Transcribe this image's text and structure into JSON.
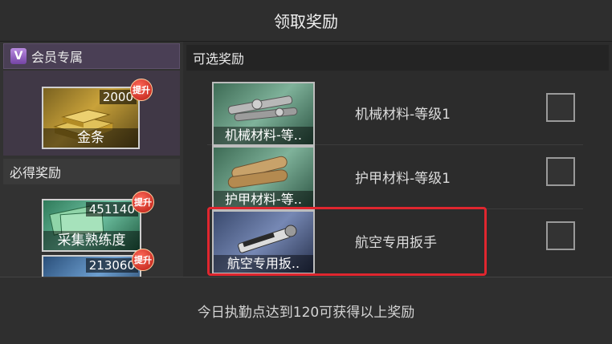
{
  "title": "领取奖励",
  "vip": {
    "header": "会员专属",
    "badge": "V",
    "item": {
      "qty": "2000",
      "name": "金条",
      "badge": "提升"
    }
  },
  "required": {
    "header": "必得奖励",
    "items": [
      {
        "qty": "451140",
        "name": "采集熟练度",
        "badge": "提升"
      },
      {
        "qty": "213060",
        "name": "",
        "badge": "提升"
      }
    ]
  },
  "optional": {
    "header": "可选奖励",
    "items": [
      {
        "thumb_name": "机械材料-等..",
        "label": "机械材料-等级1",
        "checked": false
      },
      {
        "thumb_name": "护甲材料-等..",
        "label": "护甲材料-等级1",
        "checked": false
      },
      {
        "thumb_name": "航空专用扳..",
        "label": "航空专用扳手",
        "checked": false,
        "highlighted": true
      }
    ]
  },
  "footer": {
    "text": "今日执勤点达到120可获得以上奖励"
  },
  "colors": {
    "highlight": "#e0262f",
    "vip_bg": "#4a3f55",
    "badge_red": "#b81c12"
  }
}
